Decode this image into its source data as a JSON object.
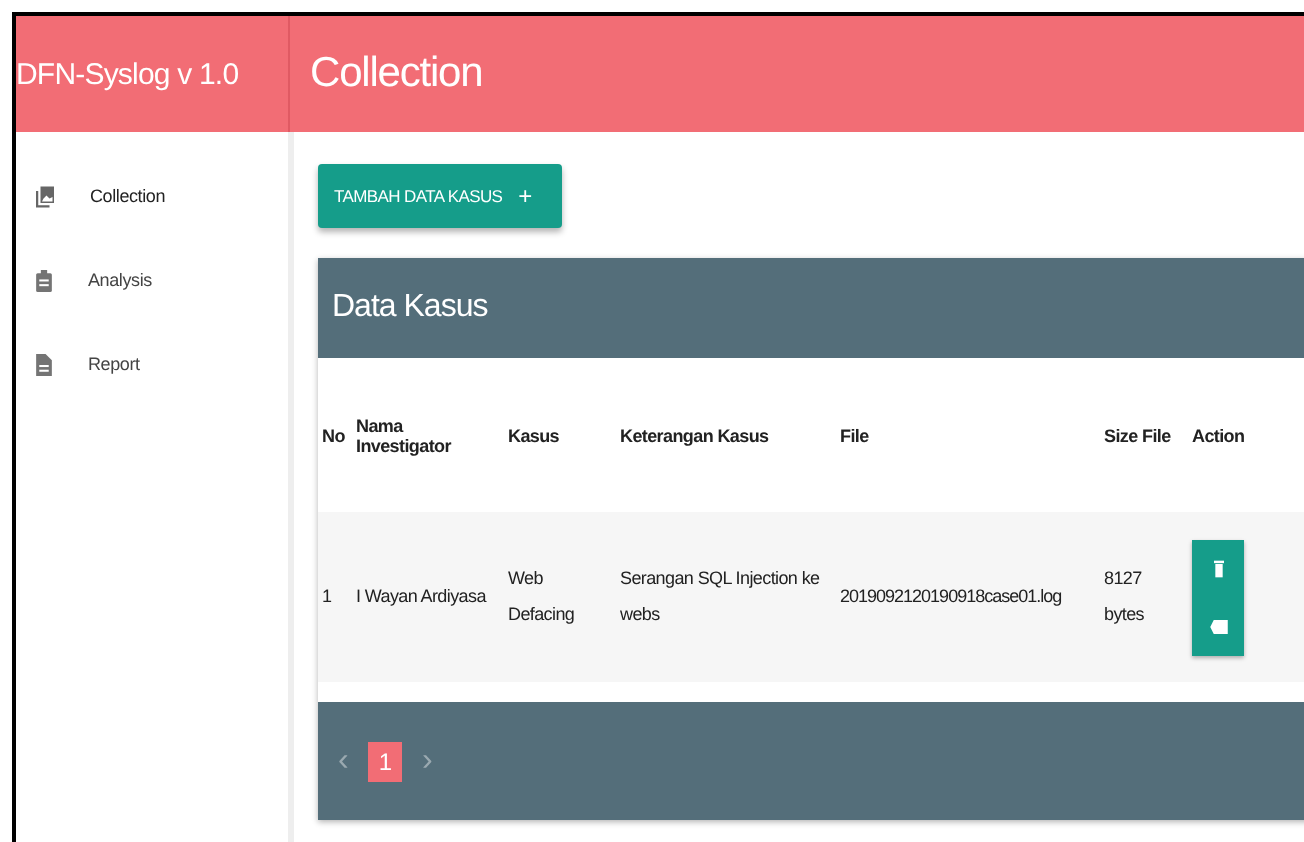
{
  "app_title": "DFN-Syslog v 1.0",
  "page_title": "Collection",
  "sidebar": {
    "items": [
      {
        "label": "Collection",
        "kind": "collection",
        "selected": true
      },
      {
        "label": "Analysis",
        "kind": "clipboard",
        "selected": false
      },
      {
        "label": "Report",
        "kind": "document",
        "selected": false
      }
    ]
  },
  "add_button": {
    "label": "TAMBAH DATA KASUS",
    "icon": "+"
  },
  "card": {
    "title": "Data Kasus",
    "table": {
      "columns": [
        "No",
        "Nama Investigator",
        "Kasus",
        "Keterangan Kasus",
        "File",
        "Size File",
        "Action"
      ],
      "rows": [
        {
          "cells": [
            "1",
            "I Wayan Ardiyasa",
            "Web Defacing",
            "Serangan SQL Injection ke webs",
            "2019092120190918case01.log",
            "8127 bytes"
          ]
        }
      ]
    },
    "pagination": {
      "prev": "‹",
      "next": "›",
      "pages": [
        {
          "label": "1",
          "selected": true
        }
      ]
    }
  }
}
